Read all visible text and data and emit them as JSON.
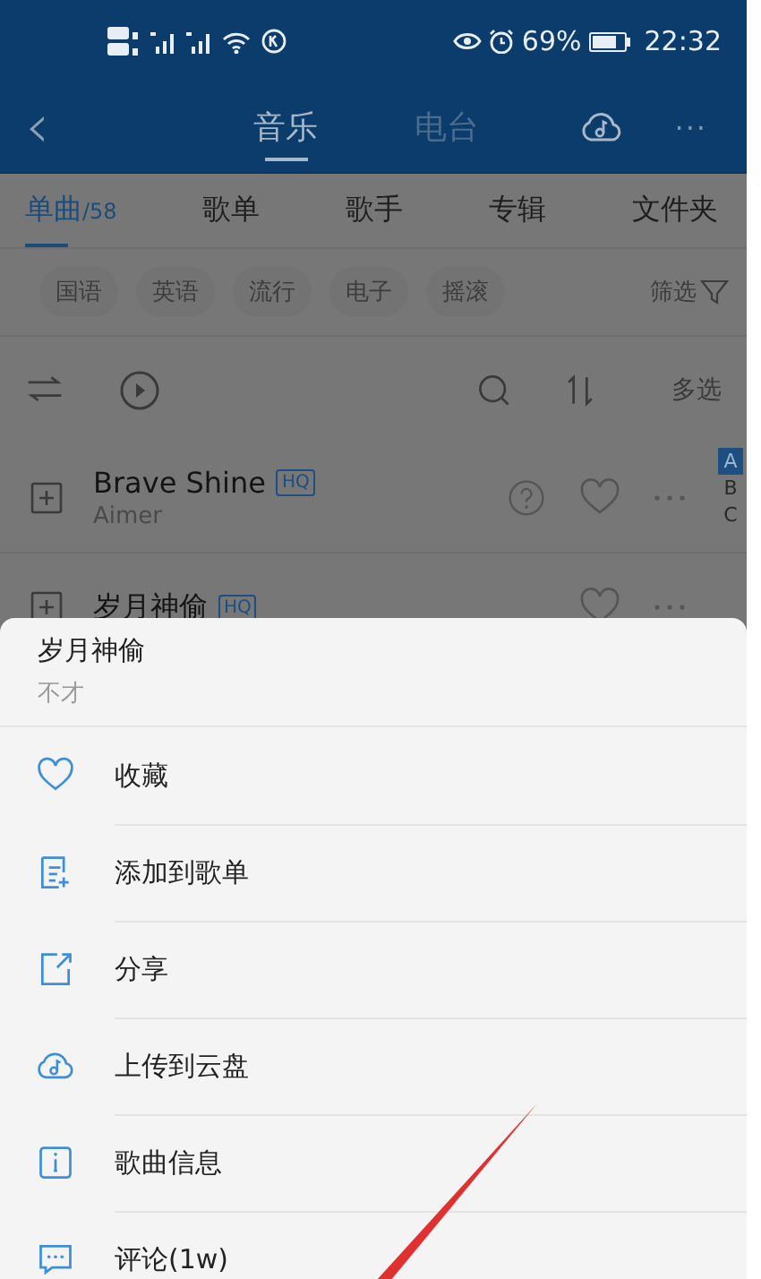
{
  "status_bar": {
    "battery": "69%",
    "time": "22:32"
  },
  "nav": {
    "back": "‹",
    "tabs": [
      {
        "label": "音乐",
        "selected": true
      },
      {
        "label": "电台",
        "selected": false
      }
    ],
    "more": "···"
  },
  "category_tabs": [
    {
      "label": "单曲",
      "count": "/58",
      "selected": true
    },
    {
      "label": "歌单",
      "selected": false
    },
    {
      "label": "歌手",
      "selected": false
    },
    {
      "label": "专辑",
      "selected": false
    },
    {
      "label": "文件夹",
      "selected": false
    }
  ],
  "filters": {
    "chips": [
      "国语",
      "英语",
      "流行",
      "电子",
      "摇滚"
    ],
    "filter_button": "筛选"
  },
  "toolbar": {
    "multi_select": "多选"
  },
  "songs": [
    {
      "title": "Brave Shine",
      "badge": "HQ",
      "artist": "Aimer",
      "help": true
    },
    {
      "title": "岁月神偷",
      "badge": "HQ",
      "help": false
    }
  ],
  "index_letters": [
    {
      "letter": "A",
      "selected": true
    },
    {
      "letter": "B",
      "selected": false
    },
    {
      "letter": "C",
      "selected": false
    }
  ],
  "sheet": {
    "title": "岁月神偷",
    "artist": "不才",
    "items": [
      {
        "kind": "favorite",
        "label": "收藏"
      },
      {
        "kind": "add_to_playlist",
        "label": "添加到歌单"
      },
      {
        "kind": "share",
        "label": "分享"
      },
      {
        "kind": "upload_cloud",
        "label": "上传到云盘"
      },
      {
        "kind": "info",
        "label": "歌曲信息"
      },
      {
        "kind": "comment",
        "label": "评论(1w)"
      }
    ]
  }
}
